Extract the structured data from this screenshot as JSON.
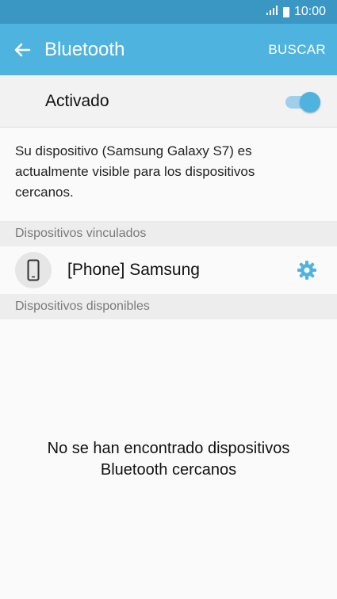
{
  "status_bar": {
    "time": "10:00"
  },
  "app_bar": {
    "title": "Bluetooth",
    "action_label": "BUSCAR"
  },
  "toggle": {
    "label": "Activado",
    "state": "on"
  },
  "description": "Su dispositivo (Samsung Galaxy S7) es actualmente visible para los dispositivos cercanos.",
  "paired": {
    "header": "Dispositivos vinculados",
    "devices": [
      {
        "name": "[Phone] Samsung",
        "icon": "phone-icon"
      }
    ]
  },
  "available": {
    "header": "Dispositivos disponibles",
    "empty_message_line1": "No se han encontrado dispositivos",
    "empty_message_line2": "Bluetooth cercanos"
  },
  "colors": {
    "accent": "#4fb3df",
    "status_bar": "#3a97c4"
  }
}
